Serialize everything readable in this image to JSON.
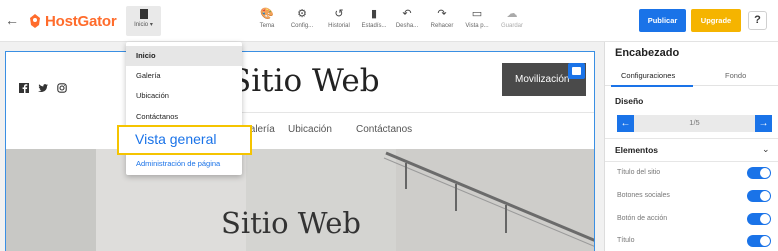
{
  "toolbar": {
    "logo_text": "HostGator",
    "page_menu_label": "Inicio",
    "tools": [
      {
        "icon": "palette-icon",
        "glyph": "🎨",
        "label": "Tema"
      },
      {
        "icon": "gear-icon",
        "glyph": "⚙",
        "label": "Config..."
      },
      {
        "icon": "history-icon",
        "glyph": "↺",
        "label": "Historial"
      },
      {
        "icon": "stats-icon",
        "glyph": "▮",
        "label": "Estadís..."
      },
      {
        "icon": "undo-icon",
        "glyph": "↶",
        "label": "Desha..."
      },
      {
        "icon": "redo-icon",
        "glyph": "↷",
        "label": "Rehacer"
      },
      {
        "icon": "monitor-icon",
        "glyph": "▭",
        "label": "Vista p..."
      },
      {
        "icon": "cloud-icon",
        "glyph": "☁",
        "label": "Guardar"
      }
    ],
    "publish_label": "Publicar",
    "upgrade_label": "Upgrade",
    "help_label": "?"
  },
  "dropdown": {
    "items": [
      "Inicio",
      "Galería",
      "Ubicación",
      "Contáctanos"
    ],
    "highlighted": "Vista general",
    "admin_link": "Administración de página"
  },
  "site": {
    "title": "Sitio Web",
    "button_label": "Movilización",
    "nav": [
      "Galería",
      "Ubicación",
      "Contáctanos"
    ],
    "hero_title": "Sitio Web"
  },
  "panel": {
    "title": "Encabezado",
    "tabs": [
      "Configuraciones",
      "Fondo"
    ],
    "design_label": "Diseño",
    "pager": "1/5",
    "elements_label": "Elementos",
    "toggles": [
      {
        "label": "Título del sitio",
        "on": true
      },
      {
        "label": "Botones sociales",
        "on": true
      },
      {
        "label": "Botón de acción",
        "on": true
      },
      {
        "label": "Título",
        "on": true
      }
    ]
  },
  "colors": {
    "accent": "#1a73e8",
    "brand": "#ff6c2c",
    "upgrade": "#f5b400",
    "highlight": "#f5c400"
  }
}
